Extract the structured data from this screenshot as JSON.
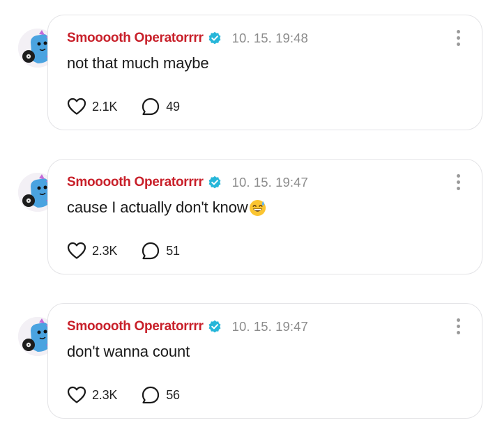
{
  "colors": {
    "author": "#c8202a",
    "verified": "#26b6d9",
    "timestamp": "#8c8c8c",
    "border": "#e3e3e6"
  },
  "posts": [
    {
      "author": "Smooooth Operatorrrr",
      "time": "10. 15. 19:48",
      "text": "not that much maybe",
      "emoji": "",
      "likes": "2.1K",
      "comments": "49"
    },
    {
      "author": "Smooooth Operatorrrr",
      "time": "10. 15. 19:47",
      "text": "cause I actually don't know",
      "emoji": "sweat-smile-emoji",
      "likes": "2.3K",
      "comments": "51"
    },
    {
      "author": "Smooooth Operatorrrr",
      "time": "10. 15. 19:47",
      "text": "don't wanna count",
      "emoji": "",
      "likes": "2.3K",
      "comments": "56"
    }
  ]
}
